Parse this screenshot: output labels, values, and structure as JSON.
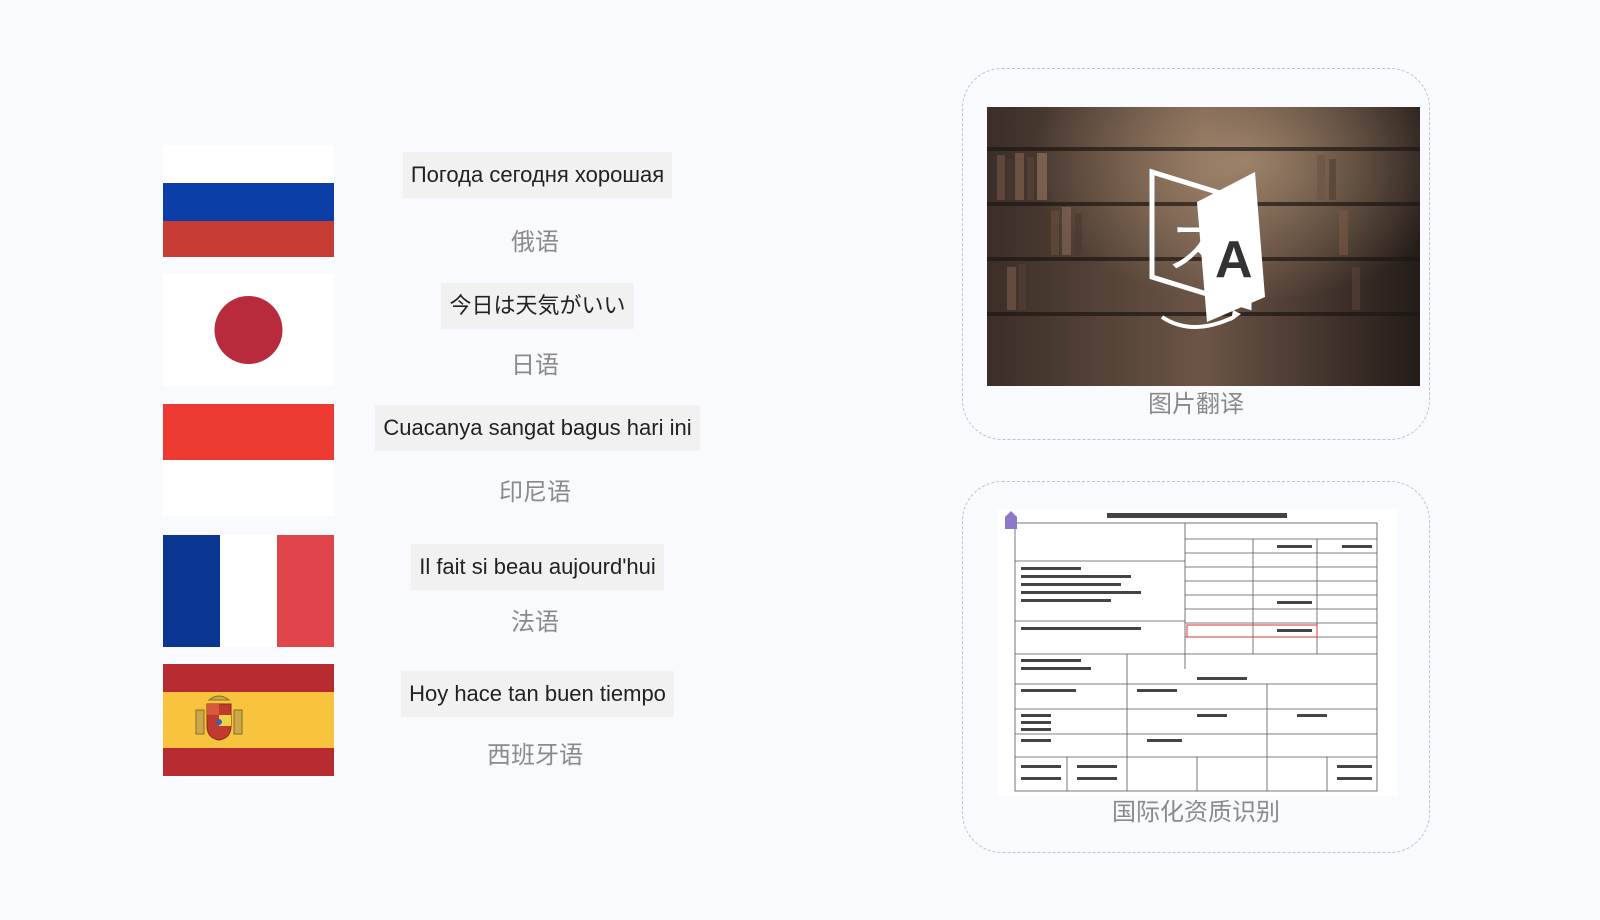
{
  "languages": [
    {
      "flag_icon": "russia-flag-icon",
      "phrase": "Погода сегодня хорошая",
      "language_name": "俄语"
    },
    {
      "flag_icon": "japan-flag-icon",
      "phrase": "今日は天気がいい",
      "language_name": "日语"
    },
    {
      "flag_icon": "indonesia-flag-icon",
      "phrase": "Cuacanya sangat bagus hari ini",
      "language_name": "印尼语"
    },
    {
      "flag_icon": "france-flag-icon",
      "phrase": "Il fait si beau aujourd'hui",
      "language_name": "法语"
    },
    {
      "flag_icon": "spain-flag-icon",
      "phrase": "Hoy hace tan buen tiempo",
      "language_name": "西班牙语"
    }
  ],
  "cards": [
    {
      "image": "translate-photo",
      "caption": "图片翻译"
    },
    {
      "image": "document-scan",
      "caption": "国际化资质识别"
    }
  ],
  "colors": {
    "background": "#f8fafd",
    "caption_gray": "#8a8a8a",
    "russia_blue": "#0c3ea7",
    "russia_red": "#c73d35",
    "japan_red": "#b82b3c",
    "indonesia_red": "#ec3a33",
    "france_blue": "#0a3591",
    "france_red": "#e0454c",
    "spain_red": "#b82b31",
    "spain_yellow": "#f8c33f"
  }
}
